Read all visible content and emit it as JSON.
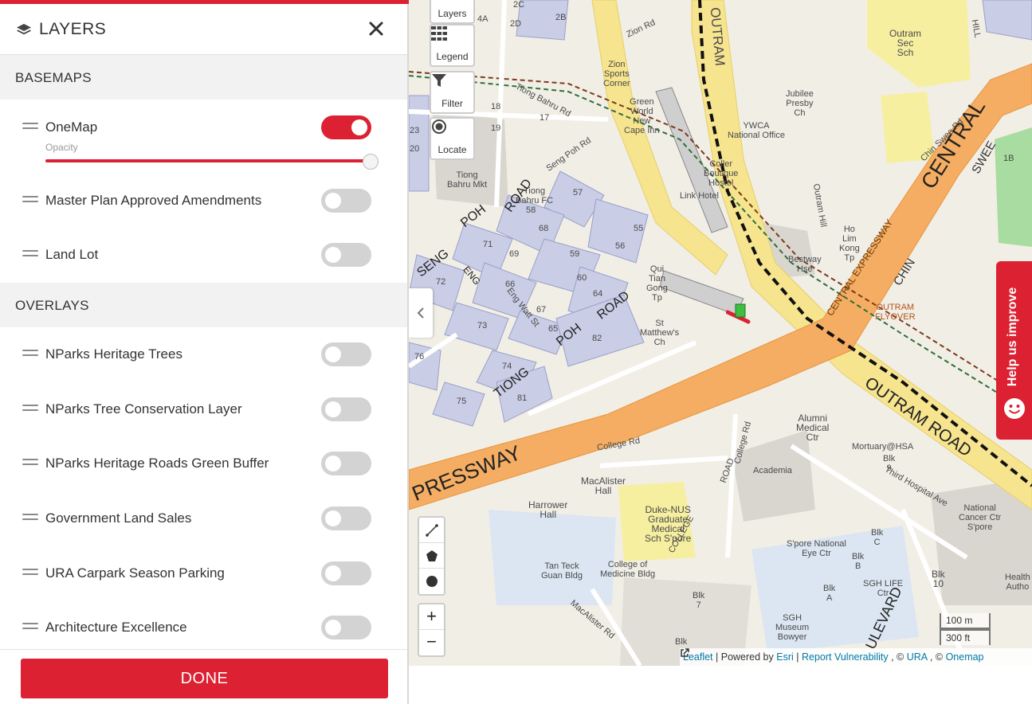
{
  "panel": {
    "title": "LAYERS",
    "basemaps_header": "BASEMAPS",
    "overlays_header": "OVERLAYS",
    "opacity_label": "Opacity",
    "opacity_value": 1.0,
    "done_label": "DONE",
    "basemaps": [
      {
        "label": "OneMap",
        "enabled": true
      },
      {
        "label": "Master Plan Approved Amendments",
        "enabled": false
      },
      {
        "label": "Land Lot",
        "enabled": false
      }
    ],
    "overlays": [
      {
        "label": "NParks Heritage Trees",
        "enabled": false
      },
      {
        "label": "NParks Tree Conservation Layer",
        "enabled": false
      },
      {
        "label": "NParks Heritage Roads Green Buffer",
        "enabled": false
      },
      {
        "label": "Government Land Sales",
        "enabled": false
      },
      {
        "label": "URA Carpark Season Parking",
        "enabled": false
      },
      {
        "label": "Architecture Excellence",
        "enabled": false
      }
    ]
  },
  "map_controls": {
    "layers": "Layers",
    "legend": "Legend",
    "filter": "Filter",
    "locate": "Locate",
    "zoom_in": "+",
    "zoom_out": "−"
  },
  "help": {
    "label": "Help us improve"
  },
  "scale": {
    "metric": "100 m",
    "imperial": "300 ft"
  },
  "attribution": {
    "leaflet": "Leaflet",
    "powered_by": "| Powered by",
    "esri": "Esri",
    "sep1": "|",
    "report": "Report Vulnerability",
    "sep2": ", ©",
    "ura": "URA",
    "sep3": ", ©",
    "onemap": "Onemap"
  },
  "map_labels": {
    "outram_sec": "Outram\nSec\nSch",
    "zion_rd": "Zion Rd",
    "zion_sports": "Zion\nSports\nCorner",
    "jubilee": "Jubilee\nPresby\nCh",
    "ywca": "YWCA\nNational Office",
    "green_world": "Green\nWorld\nNew\nCape Inn",
    "tiong_bahru_rd": "Tiong Bahru Rd",
    "seng_poh_rd": "Seng Poh Rd",
    "tiong_bahru_mkt": "Tiong\nBahru Mkt",
    "tiong_bahru_fc": "Tiong\nBahru FC",
    "outram_rd_top": "OUTRAM",
    "central": "CENTRAL",
    "central_expressway": "CENTRAL EXPRESSWAY",
    "swee": "SWEE",
    "chin_swee_rd": "Chin Swee Rd",
    "chin": "CHIN",
    "outram_flyover": "OUTRAM\nFLYOVER",
    "ho_lim": "Ho\nLim\nKong\nTp",
    "bestway": "Bestway\nHse",
    "outram_hill": "Outram Hill",
    "outram_road": "OUTRAM ROAD",
    "pressway": "PRESSWAY",
    "college_rd": "College Rd",
    "macalister": "MacAlister\nHall",
    "harrower": "Harrower\nHall",
    "duke_nus": "Duke-NUS\nGraduate\nMedical\nSch S'pore",
    "college_med": "College of\nMedicine Bldg",
    "tan_teck": "Tan Teck\nGuan Bldg",
    "academia": "Academia",
    "alumni": "Alumni\nMedical\nCtr",
    "mortuary": "Mortuary@HSA",
    "blk9": "Blk\n9",
    "third_hospital": "Third Hospital Ave",
    "nat_cancer": "National\nCancer Ctr\nS'pore",
    "spore_eye": "S'pore National\nEye Ctr",
    "sgh_life": "SGH LIFE\nCtr",
    "sgh_museum": "SGH\nMuseum\nBowyer",
    "blk10": "Blk\n10",
    "blk7": "Blk\n7",
    "blk_c": "Blk\nC",
    "blk_b": "Blk\nB",
    "blk_a": "Blk\nA",
    "health_auth": "Health\nAutho",
    "st_matthews": "St\nMatthew's\nCh",
    "qui_tian": "Qui\nTian\nGong\nTp",
    "outram_park_hostel": "Coller\nBoutique\nHostel",
    "link_hotel": "Link Hotel",
    "tiong_rd": "TIONG",
    "poh_rd": "POH",
    "road": "ROAD",
    "eng_watt": "Eng Watt St",
    "boulevard": "ULEVARD",
    "blk_bottom": "Blk",
    "macalister_rd": "MacAlister Rd",
    "college_rd_v": "College Rd",
    "road_v": "ROAD",
    "college_v": "COLLEGE",
    "seng": "SENG",
    "eng": "ENG",
    "hill": "HILL"
  },
  "block_numbers": [
    "57",
    "58",
    "68",
    "55",
    "56",
    "59",
    "71",
    "69",
    "60",
    "72",
    "66",
    "64",
    "73",
    "67",
    "65",
    "82",
    "74",
    "76",
    "75",
    "81",
    "17",
    "18",
    "19",
    "23",
    "20",
    "1B",
    "2B",
    "2C",
    "2D",
    "4A"
  ]
}
